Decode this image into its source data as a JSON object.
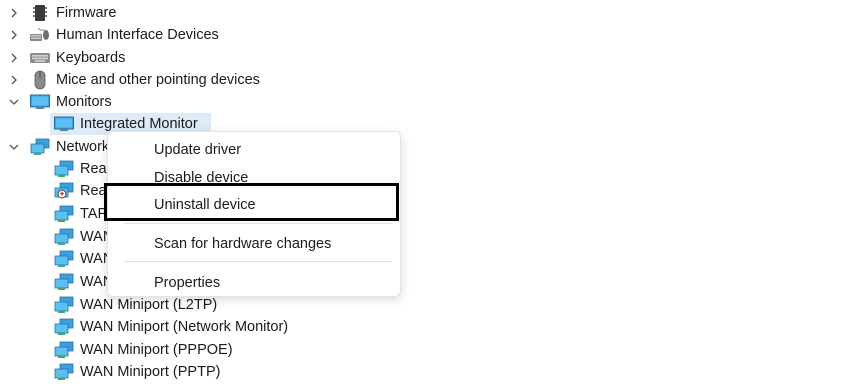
{
  "tree": {
    "firmware": {
      "label": "Firmware",
      "icon": "firmware-icon"
    },
    "hid": {
      "label": "Human Interface Devices",
      "icon": "hid-icon"
    },
    "keyboards": {
      "label": "Keyboards",
      "icon": "keyboard-icon"
    },
    "mice": {
      "label": "Mice and other pointing devices",
      "icon": "mouse-icon"
    },
    "monitors": {
      "label": "Monitors",
      "icon": "monitor-icon"
    },
    "integrated_monitor": {
      "label": "Integrated Monitor",
      "icon": "monitor-icon"
    },
    "network": {
      "label": "Network",
      "icon": "network-adapter-icon"
    },
    "network_children": [
      {
        "label": "Real",
        "icon": "network-adapter-icon"
      },
      {
        "label": "Rea",
        "icon": "network-adapter-disabled-icon"
      },
      {
        "label": "TAP",
        "icon": "network-adapter-icon"
      },
      {
        "label": "WAN",
        "icon": "network-adapter-icon"
      },
      {
        "label": "WAN",
        "icon": "network-adapter-icon"
      },
      {
        "label": "WAN",
        "icon": "network-adapter-icon"
      },
      {
        "label": "WAN Miniport (L2TP)",
        "icon": "network-adapter-icon"
      },
      {
        "label": "WAN Miniport (Network Monitor)",
        "icon": "network-adapter-icon"
      },
      {
        "label": "WAN Miniport (PPPOE)",
        "icon": "network-adapter-icon"
      },
      {
        "label": "WAN Miniport (PPTP)",
        "icon": "network-adapter-icon"
      }
    ]
  },
  "context_menu": {
    "update_driver": "Update driver",
    "disable_device": "Disable device",
    "uninstall_device": "Uninstall device",
    "scan_hardware": "Scan for hardware changes",
    "properties": "Properties"
  },
  "colors": {
    "selection": "#dcebf7",
    "highlight_box": "#000000",
    "monitor_blue": "#3aa0e0",
    "network_green": "#4aa564"
  }
}
